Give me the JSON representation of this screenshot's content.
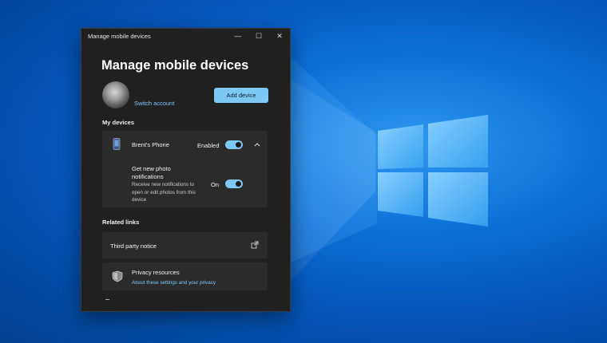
{
  "window": {
    "title": "Manage mobile devices",
    "heading": "Manage mobile devices",
    "minimize": "—",
    "maximize": "☐",
    "close": "✕"
  },
  "account": {
    "switch_label": "Switch account",
    "add_device_label": "Add device"
  },
  "devices": {
    "section_label": "My devices",
    "items": [
      {
        "name": "Brent's Phone",
        "status": "Enabled",
        "enabled": true,
        "setting_title": "Get new photo notifications",
        "setting_desc": "Receive new notifications to open or edit photos from this device",
        "setting_state": "On",
        "setting_on": true
      }
    ]
  },
  "related": {
    "section_label": "Related links",
    "third_party": "Third party notice",
    "privacy_title": "Privacy resources",
    "privacy_links": "About these settings and your privacy"
  },
  "colors": {
    "accent": "#7ec8f5",
    "window_bg": "#202020",
    "card_bg": "#2b2b2b",
    "link": "#7fc8ff"
  }
}
